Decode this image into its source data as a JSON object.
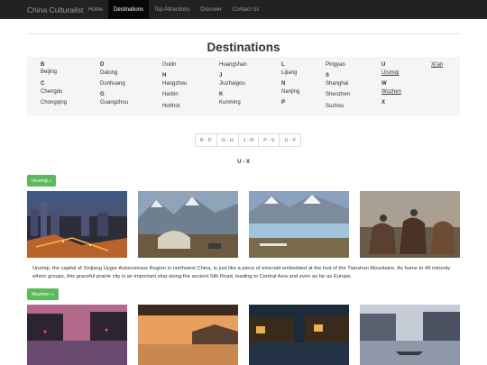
{
  "nav": {
    "brand": "China Culturalist",
    "items": [
      {
        "label": "Home",
        "active": false
      },
      {
        "label": "Destinations",
        "active": true
      },
      {
        "label": "Top Attractions",
        "active": false
      },
      {
        "label": "Discover",
        "active": false
      },
      {
        "label": "Contact Us",
        "active": false
      }
    ]
  },
  "page_title": "Destinations",
  "destinations": {
    "letters": {
      "b": "B",
      "c": "C",
      "d": "D",
      "g": "G",
      "h": "H",
      "j": "J",
      "k": "K",
      "l": "L",
      "n": "N",
      "p": "P",
      "s": "S",
      "u": "U",
      "w": "W",
      "x": "X"
    },
    "cities": {
      "beijing": "Beijing",
      "chengdu": "Chengdu",
      "chongqing": "Chongqing",
      "datong": "Datong",
      "dunhuang": "Dunhuang",
      "guangzhou": "Guangzhou",
      "guilin": "Guilin",
      "hangzhou": "Hangzhou",
      "harbin": "Harbin",
      "hohhot": "Hohhot",
      "huangshan": "Huangshan",
      "jiuzhaigou": "Jiuzhaigou",
      "kunming": "Kunming",
      "lijiang": "Lijiang",
      "nanjing": "Nanjing",
      "pingyao": "Pingyao",
      "shanghai": "Shanghai",
      "shenzhen": "Shenzhen",
      "suzhou": "Suzhou",
      "urumqi": "Urumqi",
      "wuzhen": "Wuzhen",
      "xian": "Xi'an"
    }
  },
  "pager": [
    "B - D",
    "G - H",
    "J - N",
    "P - S",
    "U - X"
  ],
  "section_range": "U - X",
  "urumqi": {
    "button": "Urumqi »",
    "caption": "Urumqi, the capital of Xinjiang Uygur Autonomous Region in northwest China, is just like a piece of emerald embedded at the foot of the Tianshan Mountains. As home to 49 minority ethnic groups, this graceful prairie city is an important stop along the ancient Silk Road, leading to Central Asia and even as far as Europe."
  },
  "wuzhen": {
    "button": "Wuzhen »"
  },
  "colors": {
    "navbar": "#222222",
    "accent_green": "#5cb85c",
    "link_blue": "#337ab7",
    "panel": "#f5f5f5"
  }
}
